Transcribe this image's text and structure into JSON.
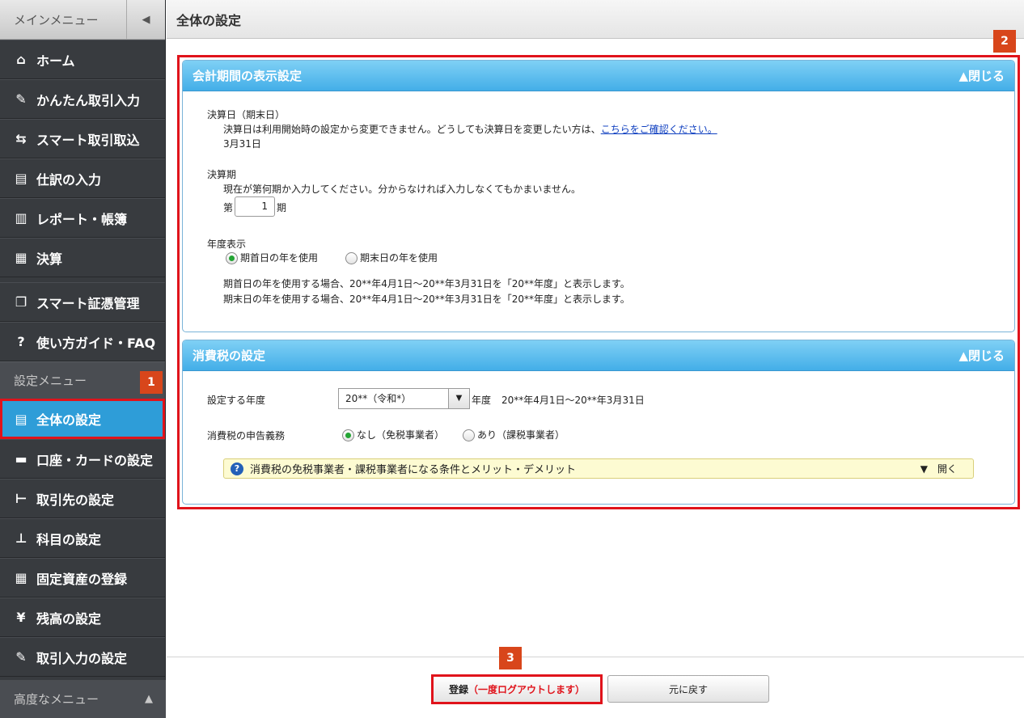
{
  "sidebar": {
    "main_menu_label": "メインメニュー",
    "collapse_glyph": "◀",
    "main_items": [
      {
        "label": "ホーム",
        "icon": "home-icon",
        "glyph": "⌂"
      },
      {
        "label": "かんたん取引入力",
        "icon": "pencil-icon",
        "glyph": "✎"
      },
      {
        "label": "スマート取引取込",
        "icon": "import-icon",
        "glyph": "⇆"
      },
      {
        "label": "仕訳の入力",
        "icon": "journal-icon",
        "glyph": "▤"
      },
      {
        "label": "レポート・帳簿",
        "icon": "chart-icon",
        "glyph": "▥"
      },
      {
        "label": "決算",
        "icon": "calculator-icon",
        "glyph": "▦"
      },
      {
        "label": "スマート証憑管理",
        "icon": "document-icon",
        "glyph": "❐"
      },
      {
        "label": "使い方ガイド・FAQ",
        "icon": "help-icon",
        "glyph": "?"
      }
    ],
    "settings_menu_label": "設定メニュー",
    "settings_items": [
      {
        "label": "全体の設定",
        "icon": "settings-list-icon",
        "glyph": "▤"
      },
      {
        "label": "口座・カードの設定",
        "icon": "card-icon",
        "glyph": "▬"
      },
      {
        "label": "取引先の設定",
        "icon": "partner-icon",
        "glyph": "⊢"
      },
      {
        "label": "科目の設定",
        "icon": "tree-icon",
        "glyph": "⊥"
      },
      {
        "label": "固定資産の登録",
        "icon": "building-icon",
        "glyph": "▦"
      },
      {
        "label": "残高の設定",
        "icon": "yen-icon",
        "glyph": "¥"
      },
      {
        "label": "取引入力の設定",
        "icon": "edit-settings-icon",
        "glyph": "✎"
      }
    ],
    "advanced_menu_label": "高度なメニュー",
    "advanced_glyph": "▲"
  },
  "header": {
    "title": "全体の設定"
  },
  "badges": {
    "one": "1",
    "two": "2",
    "three": "3"
  },
  "accounting_panel": {
    "title": "会計期間の表示設定",
    "close_label": "▲閉じる",
    "closing_date_label": "決算日（期末日）",
    "closing_date_note": "決算日は利用開始時の設定から変更できません。どうしても決算日を変更したい方は、",
    "closing_date_link": "こちらをご確認ください。",
    "closing_date_value": "3月31日",
    "fiscal_period_label": "決算期",
    "fiscal_period_note": "現在が第何期か入力してください。分からなければ入力しなくてもかまいません。",
    "period_prefix": "第",
    "period_value": "1",
    "period_suffix": "期",
    "year_display_label": "年度表示",
    "radio_start": "期首日の年を使用",
    "radio_end": "期末日の年を使用",
    "year_display_note1": "期首日の年を使用する場合、20**年4月1日～20**年3月31日を「20**年度」と表示します。",
    "year_display_note2": "期末日の年を使用する場合、20**年4月1日～20**年3月31日を「20**年度」と表示します。"
  },
  "tax_panel": {
    "title": "消費税の設定",
    "close_label": "▲閉じる",
    "year_label": "設定する年度",
    "year_select_value": "20**（令和*）",
    "year_suffix": "年度",
    "year_range": "20**年4月1日～20**年3月31日",
    "filing_label": "消費税の申告義務",
    "radio_none": "なし（免税事業者）",
    "radio_yes": "あり（課税事業者）",
    "info_text": "消費税の免税事業者・課税事業者になる条件とメリット・デメリット",
    "info_open": "▼　開く"
  },
  "footer": {
    "register_label": "登録",
    "register_note": "（一度ログアウトします）",
    "reset_label": "元に戻す"
  },
  "colors": {
    "accent": "#2e9dd8",
    "highlight": "#e0131b",
    "badge": "#d8461b"
  }
}
